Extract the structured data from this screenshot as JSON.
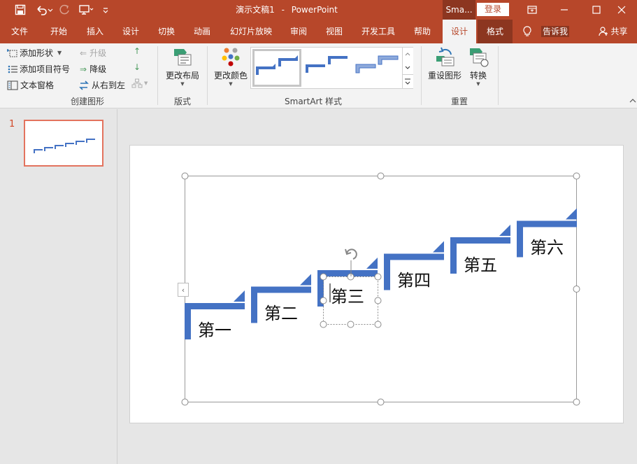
{
  "title_bar": {
    "document_title": "演示文稿1",
    "separator": "-",
    "app_name": "PowerPoint",
    "smartart_context": "Sma...",
    "login_label": "登录"
  },
  "tabs": [
    {
      "label": "文件"
    },
    {
      "label": "开始"
    },
    {
      "label": "插入"
    },
    {
      "label": "设计"
    },
    {
      "label": "切换"
    },
    {
      "label": "动画"
    },
    {
      "label": "幻灯片放映"
    },
    {
      "label": "审阅"
    },
    {
      "label": "视图"
    },
    {
      "label": "开发工具"
    },
    {
      "label": "帮助"
    },
    {
      "label": "设计"
    },
    {
      "label": "格式"
    }
  ],
  "tell_me": "告诉我",
  "share": "共享",
  "ribbon": {
    "create_graphic": {
      "add_shape": "添加形状",
      "add_bullet": "添加项目符号",
      "text_pane": "文本窗格",
      "promote": "升级",
      "demote": "降级",
      "right_to_left": "从右到左",
      "label": "创建图形"
    },
    "layouts": {
      "change_layout": "更改布局",
      "label": "版式"
    },
    "styles": {
      "change_colors": "更改颜色",
      "label": "SmartArt 样式"
    },
    "reset": {
      "reset_graphic": "重设图形",
      "convert": "转换",
      "label": "重置"
    }
  },
  "slide_panel": {
    "slide_number": "1"
  },
  "smartart": {
    "steps": [
      "第一",
      "第二",
      "第三",
      "第四",
      "第五",
      "第六"
    ],
    "color": "#4472c4"
  },
  "colors": {
    "accent": "#b7472a",
    "accent_dark": "#8c3620",
    "shape_blue": "#4472c4"
  }
}
